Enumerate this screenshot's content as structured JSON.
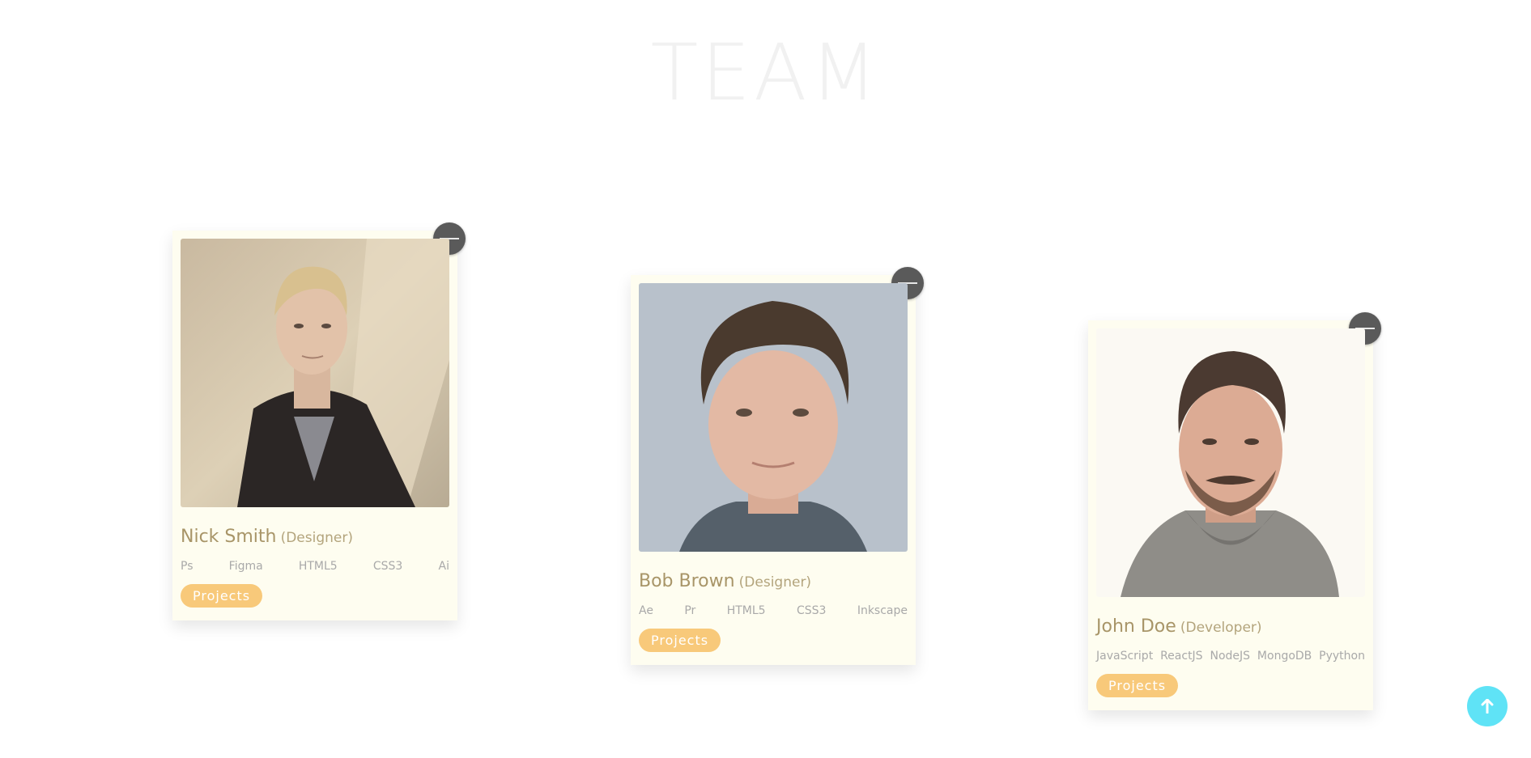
{
  "section": {
    "title": "TEAM"
  },
  "members": [
    {
      "name": "Nick Smith",
      "role": "(Designer)",
      "skills": [
        "Ps",
        "Figma",
        "HTML5",
        "CSS3",
        "Ai"
      ],
      "button_label": "Projects"
    },
    {
      "name": "Bob Brown",
      "role": "(Designer)",
      "skills": [
        "Ae",
        "Pr",
        "HTML5",
        "CSS3",
        "Inkscape"
      ],
      "button_label": "Projects"
    },
    {
      "name": "John Doe",
      "role": "(Developer)",
      "skills": [
        "JavaScript",
        "ReactJS",
        "NodeJS",
        "MongoDB",
        "Pyython"
      ],
      "button_label": "Projects"
    }
  ],
  "icons": {
    "card_remove": "minus-icon",
    "scroll_top": "arrow-up-icon"
  },
  "colors": {
    "card_bg": "#fefdf0",
    "projects_button": "#f8c97a",
    "scroll_top_button": "#5fe3f6",
    "remove_button": "#5a5a5a"
  }
}
